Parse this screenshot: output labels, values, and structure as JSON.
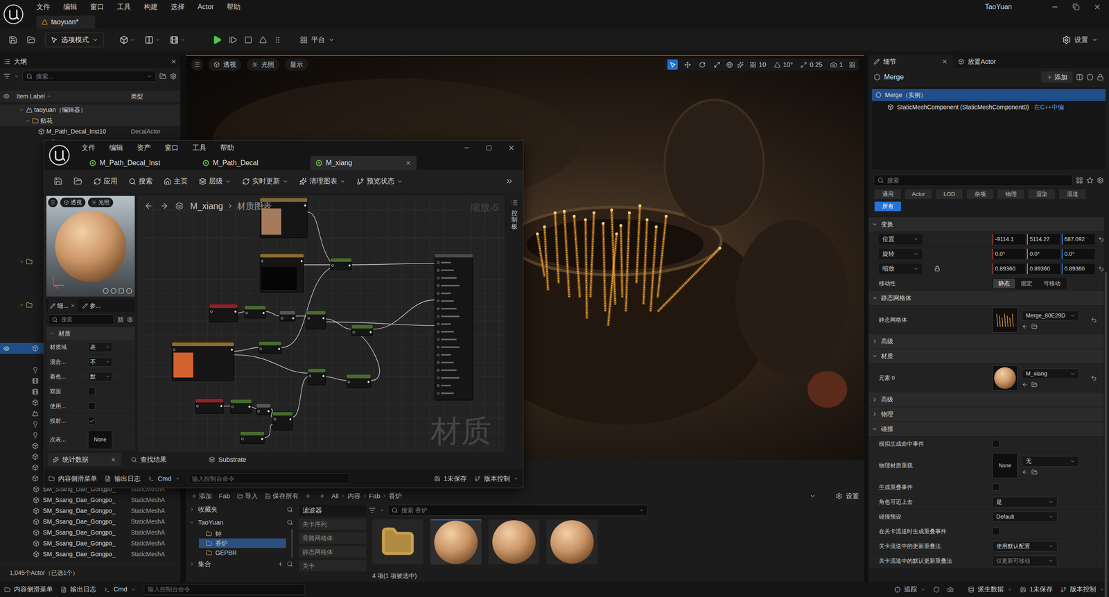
{
  "main_window": {
    "menu": [
      "文件",
      "编辑",
      "窗口",
      "工具",
      "构建",
      "选择",
      "Actor",
      "帮助"
    ],
    "level_tab": "taoyuan*",
    "user": "TaoYuan"
  },
  "toolbar": {
    "mode": "选项模式",
    "platform": "平台",
    "settings": "设置"
  },
  "outliner": {
    "tab": "大纲",
    "search_placeholder": "搜索...",
    "columns": [
      "Item Label",
      "类型"
    ],
    "rows": [
      {
        "label": "taoyuan（编辑器）",
        "type": "",
        "kind": "level",
        "depth": 1,
        "expanded": true,
        "selected": false
      },
      {
        "label": "贴花",
        "type": "",
        "kind": "folder",
        "depth": 2,
        "expanded": true,
        "selected": false
      },
      {
        "label": "M_Path_Decal_Inst10",
        "type": "DecalActor",
        "kind": "actor",
        "depth": 3,
        "expanded": false,
        "selected": false
      }
    ],
    "covered_rows": [
      {
        "kind": "actor",
        "depth": 5,
        "selected": false
      },
      {
        "kind": "actor",
        "depth": 5,
        "selected": false
      },
      {
        "kind": "actor",
        "depth": 5,
        "selected": false
      },
      {
        "kind": "actor",
        "depth": 5,
        "selected": false
      },
      {
        "kind": "actor",
        "depth": 5,
        "selected": false
      },
      {
        "kind": "actor",
        "depth": 5,
        "selected": false
      },
      {
        "kind": "actor",
        "depth": 5,
        "selected": false
      },
      {
        "kind": "actor",
        "depth": 5,
        "selected": false
      },
      {
        "kind": "actor",
        "depth": 5,
        "selected": false
      },
      {
        "kind": "actor",
        "depth": 5,
        "selected": false
      },
      {
        "kind": "actor",
        "depth": 5,
        "selected": false
      },
      {
        "kind": "folder",
        "depth": 1,
        "selected": false
      },
      {
        "kind": "actor",
        "depth": 5,
        "selected": false
      },
      {
        "kind": "actor",
        "depth": 5,
        "selected": false
      },
      {
        "kind": "actor",
        "depth": 5,
        "selected": false
      },
      {
        "kind": "folder",
        "depth": 1,
        "selected": false
      },
      {
        "kind": "actor",
        "depth": 5,
        "selected": false
      },
      {
        "kind": "actor",
        "depth": 5,
        "selected": false
      },
      {
        "kind": "actor",
        "depth": 5,
        "selected": false
      },
      {
        "kind": "mesh",
        "depth": 2,
        "selected": true
      },
      {
        "kind": "actor",
        "depth": 5,
        "selected": false
      },
      {
        "kind": "light",
        "depth": 2,
        "selected": false
      },
      {
        "kind": "film",
        "depth": 2,
        "selected": false
      },
      {
        "kind": "film",
        "depth": 2,
        "selected": false
      },
      {
        "kind": "actor",
        "depth": 2,
        "selected": false
      },
      {
        "kind": "sky",
        "depth": 2,
        "selected": false
      },
      {
        "kind": "light",
        "depth": 2,
        "selected": false
      },
      {
        "kind": "light",
        "depth": 2,
        "selected": false
      },
      {
        "kind": "mesh",
        "depth": 2,
        "selected": false
      },
      {
        "kind": "actor",
        "depth": 2,
        "selected": false
      },
      {
        "kind": "mesh",
        "depth": 2,
        "selected": false
      },
      {
        "kind": "mesh",
        "depth": 2,
        "selected": false
      }
    ],
    "bottom_rows": [
      {
        "label": "SM_Ssang_Dae_Gongpo_",
        "type": "StaticMeshA"
      },
      {
        "label": "SM_Ssang_Dae_Gongpo_",
        "type": "StaticMeshA"
      },
      {
        "label": "SM_Ssang_Dae_Gongpo_",
        "type": "StaticMeshA"
      },
      {
        "label": "SM_Ssang_Dae_Gongpo_",
        "type": "StaticMeshA"
      },
      {
        "label": "SM_Ssang_Dae_Gongpo_",
        "type": "StaticMeshA"
      },
      {
        "label": "SM_Ssang_Dae_Gongpo_",
        "type": "StaticMeshA"
      },
      {
        "label": "SM_Ssang_Dae_Gongpo_",
        "type": "StaticMeshA"
      }
    ],
    "footer": "1,045个Actor（已选1个）"
  },
  "viewport": {
    "buttons": [
      "透视",
      "光照",
      "显示"
    ],
    "tools": [
      {
        "kind": "select",
        "selected": true
      },
      {
        "kind": "move",
        "selected": false
      },
      {
        "kind": "rotate",
        "selected": false
      },
      {
        "kind": "scale",
        "selected": false
      }
    ],
    "snaps": [
      {
        "kind": "grid",
        "value": "10"
      },
      {
        "kind": "angle",
        "value": "10°"
      },
      {
        "kind": "scale",
        "value": "0.25"
      },
      {
        "kind": "camera",
        "value": "1"
      }
    ]
  },
  "content_browser": {
    "toolbar": [
      "添加",
      "Fab",
      "导入",
      "保存所有"
    ],
    "path": [
      "All",
      "内容",
      "Fab",
      "香炉"
    ],
    "settings": "设置",
    "favorites": "收藏夹",
    "root": "TaoYuan",
    "folders": [
      {
        "label": "钟",
        "selected": false
      },
      {
        "label": "香炉",
        "selected": true
      },
      {
        "label": "GEPBR",
        "selected": false
      }
    ],
    "collections": "集合",
    "filters_title": "滤波器",
    "filters": [
      "关卡序列",
      "骨骼网格体",
      "静态网格体",
      "关卡"
    ],
    "search": "搜索 香炉",
    "assets": [
      {
        "kind": "folder",
        "selected": false
      },
      {
        "kind": "material",
        "selected": true
      },
      {
        "kind": "material",
        "selected": false
      },
      {
        "kind": "material",
        "selected": false
      }
    ],
    "footer": "4 项(1 项被选中)"
  },
  "details": {
    "tabs": [
      {
        "label": "细节",
        "selected": true,
        "closable": true
      },
      {
        "label": "放置Actor",
        "selected": false,
        "closable": false
      }
    ],
    "actor": "Merge",
    "add": "添加",
    "components": [
      {
        "label": "Merge（实例）",
        "link": "",
        "depth": 0,
        "selected": true
      },
      {
        "label": "StaticMeshComponent (StaticMeshComponent0)",
        "link": "在C++中编",
        "depth": 1,
        "selected": false
      }
    ],
    "search": "搜索",
    "filters": [
      {
        "label": "通用",
        "selected": false
      },
      {
        "label": "Actor",
        "selected": false
      },
      {
        "label": "LOD",
        "selected": false
      },
      {
        "label": "杂项",
        "selected": false
      },
      {
        "label": "物理",
        "selected": false
      },
      {
        "label": "渲染",
        "selected": false
      },
      {
        "label": "流送",
        "selected": false
      },
      {
        "label": "所有",
        "selected": true
      }
    ],
    "rows": [
      {
        "kind": "section",
        "label": "变换",
        "expanded": true
      },
      {
        "kind": "vector",
        "label": "位置",
        "values": [
          "-9114.1",
          "5114.27",
          "687.092"
        ],
        "locked": false,
        "modified": true
      },
      {
        "kind": "vector",
        "label": "旋转",
        "values": [
          "0.0°",
          "0.0°",
          "0.0°"
        ],
        "locked": false,
        "modified": false
      },
      {
        "kind": "vector",
        "label": "缩放",
        "values": [
          "0.89360",
          "0.89360",
          "0.89360"
        ],
        "locked": true,
        "modified": true
      },
      {
        "kind": "segmented",
        "label": "移动性",
        "options": [
          {
            "label": "静态",
            "selected": true
          },
          {
            "label": "固定",
            "selected": false
          },
          {
            "label": "可移动",
            "selected": false
          }
        ]
      },
      {
        "kind": "section",
        "label": "静态网格体",
        "expanded": true
      },
      {
        "kind": "asset",
        "label": "静态网格体",
        "value": "Merge_80E29D",
        "thumb": "mesh",
        "thumb_label": "",
        "modified": true
      },
      {
        "kind": "section",
        "label": "高级",
        "expanded": false
      },
      {
        "kind": "section",
        "label": "材质",
        "expanded": true
      },
      {
        "kind": "asset",
        "label": "元素 0",
        "value": "M_xiang",
        "thumb": "sphere",
        "thumb_label": "",
        "modified": true
      },
      {
        "kind": "section",
        "label": "高级",
        "expanded": false
      },
      {
        "kind": "section",
        "label": "物理",
        "expanded": false
      },
      {
        "kind": "section",
        "label": "碰撞",
        "expanded": true
      },
      {
        "kind": "checkbox",
        "label": "模拟生成命中事件",
        "checked": false
      },
      {
        "kind": "asset",
        "label": "物理材质重载",
        "value": "无",
        "thumb": "none",
        "thumb_label": "None",
        "modified": false
      },
      {
        "kind": "checkbox",
        "label": "生成重叠事件",
        "checked": false
      },
      {
        "kind": "dropdown",
        "label": "角色可迈上去",
        "value": "是",
        "disabled": false
      },
      {
        "kind": "dropdown",
        "label": "碰撞预设",
        "value": "Default",
        "disabled": false
      },
      {
        "kind": "checkbox",
        "label": "在关卡流送时生成重叠事件",
        "checked": false
      },
      {
        "kind": "dropdown",
        "label": "关卡流送中的更新重叠法",
        "value": "使用默认配置",
        "disabled": false
      },
      {
        "kind": "dropdown",
        "label": "关卡流送中的默认更新重叠法",
        "value": "仅更新可移动",
        "disabled": true
      }
    ]
  },
  "material_editor": {
    "menu": [
      "文件",
      "编辑",
      "资产",
      "窗口",
      "工具",
      "帮助"
    ],
    "tabs": [
      {
        "label": "M_Path_Decal_Inst",
        "selected": false
      },
      {
        "label": "M_Path_Decal",
        "selected": false
      },
      {
        "label": "M_xiang",
        "selected": true
      }
    ],
    "toolbar": [
      {
        "label": "应用",
        "kind": "apply",
        "dropdown": false
      },
      {
        "label": "搜索",
        "kind": "search",
        "dropdown": false
      },
      {
        "label": "主页",
        "kind": "home",
        "dropdown": false
      },
      {
        "label": "层级",
        "kind": "hierarchy",
        "dropdown": true
      },
      {
        "label": "实时更新",
        "kind": "live",
        "dropdown": true
      },
      {
        "label": "清理图表",
        "kind": "clean",
        "dropdown": true
      },
      {
        "label": "预览状态",
        "kind": "preview",
        "dropdown": true
      }
    ],
    "preview_buttons": [
      "透视",
      "光照"
    ],
    "detail_tabs": [
      {
        "label": "细...",
        "selected": true
      },
      {
        "label": "参...",
        "selected": false
      }
    ],
    "search": "搜索",
    "section": "材质",
    "props": [
      {
        "label": "材质域",
        "kind": "dropdown",
        "value": "表",
        "checked": false
      },
      {
        "label": "混合...",
        "kind": "dropdown",
        "value": "不",
        "checked": false
      },
      {
        "label": "着色...",
        "kind": "dropdown",
        "value": "默",
        "checked": false
      },
      {
        "label": "双面",
        "kind": "checkbox",
        "value": "",
        "checked": false
      },
      {
        "label": "使用...",
        "kind": "checkbox",
        "value": "",
        "checked": false
      },
      {
        "label": "投射...",
        "kind": "checkbox",
        "value": "",
        "checked": true
      },
      {
        "label": "次表...",
        "kind": "asset",
        "value": "None",
        "checked": false
      }
    ],
    "graph": {
      "breadcrumb": [
        "M_xiang",
        "材质图表"
      ],
      "zoom": "缩放-5",
      "watermark": "材质",
      "palette": "控制板",
      "nodes": [
        {
          "kind": "swatch",
          "color": "#7c6a3c",
          "swatch": "#a47b5c"
        },
        {
          "kind": "preview",
          "color": "#8c6d2c",
          "swatch": "#050505"
        },
        {
          "kind": "node",
          "color": "#476b2e",
          "swatch": ""
        },
        {
          "kind": "result",
          "color": "#4a4a4a",
          "swatch": ""
        },
        {
          "kind": "node",
          "color": "#8e2323",
          "swatch": ""
        },
        {
          "kind": "node",
          "color": "#476b2e",
          "swatch": ""
        },
        {
          "kind": "node",
          "color": "#555555",
          "swatch": ""
        },
        {
          "kind": "node",
          "color": "#476b2e",
          "swatch": ""
        },
        {
          "kind": "node",
          "color": "#476b2e",
          "swatch": ""
        },
        {
          "kind": "swatch",
          "color": "#8c6d2c",
          "swatch": "#d4622f"
        },
        {
          "kind": "node",
          "color": "#476b2e",
          "swatch": ""
        },
        {
          "kind": "node",
          "color": "#476b2e",
          "swatch": ""
        },
        {
          "kind": "node",
          "color": "#476b2e",
          "swatch": ""
        },
        {
          "kind": "node",
          "color": "#8e2323",
          "swatch": ""
        },
        {
          "kind": "node",
          "color": "#476b2e",
          "swatch": ""
        },
        {
          "kind": "node",
          "color": "#555555",
          "swatch": ""
        },
        {
          "kind": "node",
          "color": "#476b2e",
          "swatch": ""
        },
        {
          "kind": "node",
          "color": "#476b2e",
          "swatch": ""
        }
      ]
    },
    "bottom_tabs": [
      {
        "label": "统计数据",
        "closable": true
      },
      {
        "label": "查找结果",
        "closable": false
      },
      {
        "label": "Substrate",
        "closable": false
      }
    ],
    "bottom_bar": {
      "drawer": "内容侧滑菜单",
      "log": "输出日志",
      "cmd": "Cmd",
      "console": "输入控制台命令",
      "unsaved": "1未保存",
      "source": "版本控制"
    }
  },
  "status_bar": {
    "drawer": "内容侧滑菜单",
    "log": "输出日志",
    "cmd": "Cmd",
    "console": "输入控制台命令",
    "trace": "追踪",
    "ddc": "派生数据",
    "unsaved": "1未保存",
    "source": "版本控制"
  }
}
